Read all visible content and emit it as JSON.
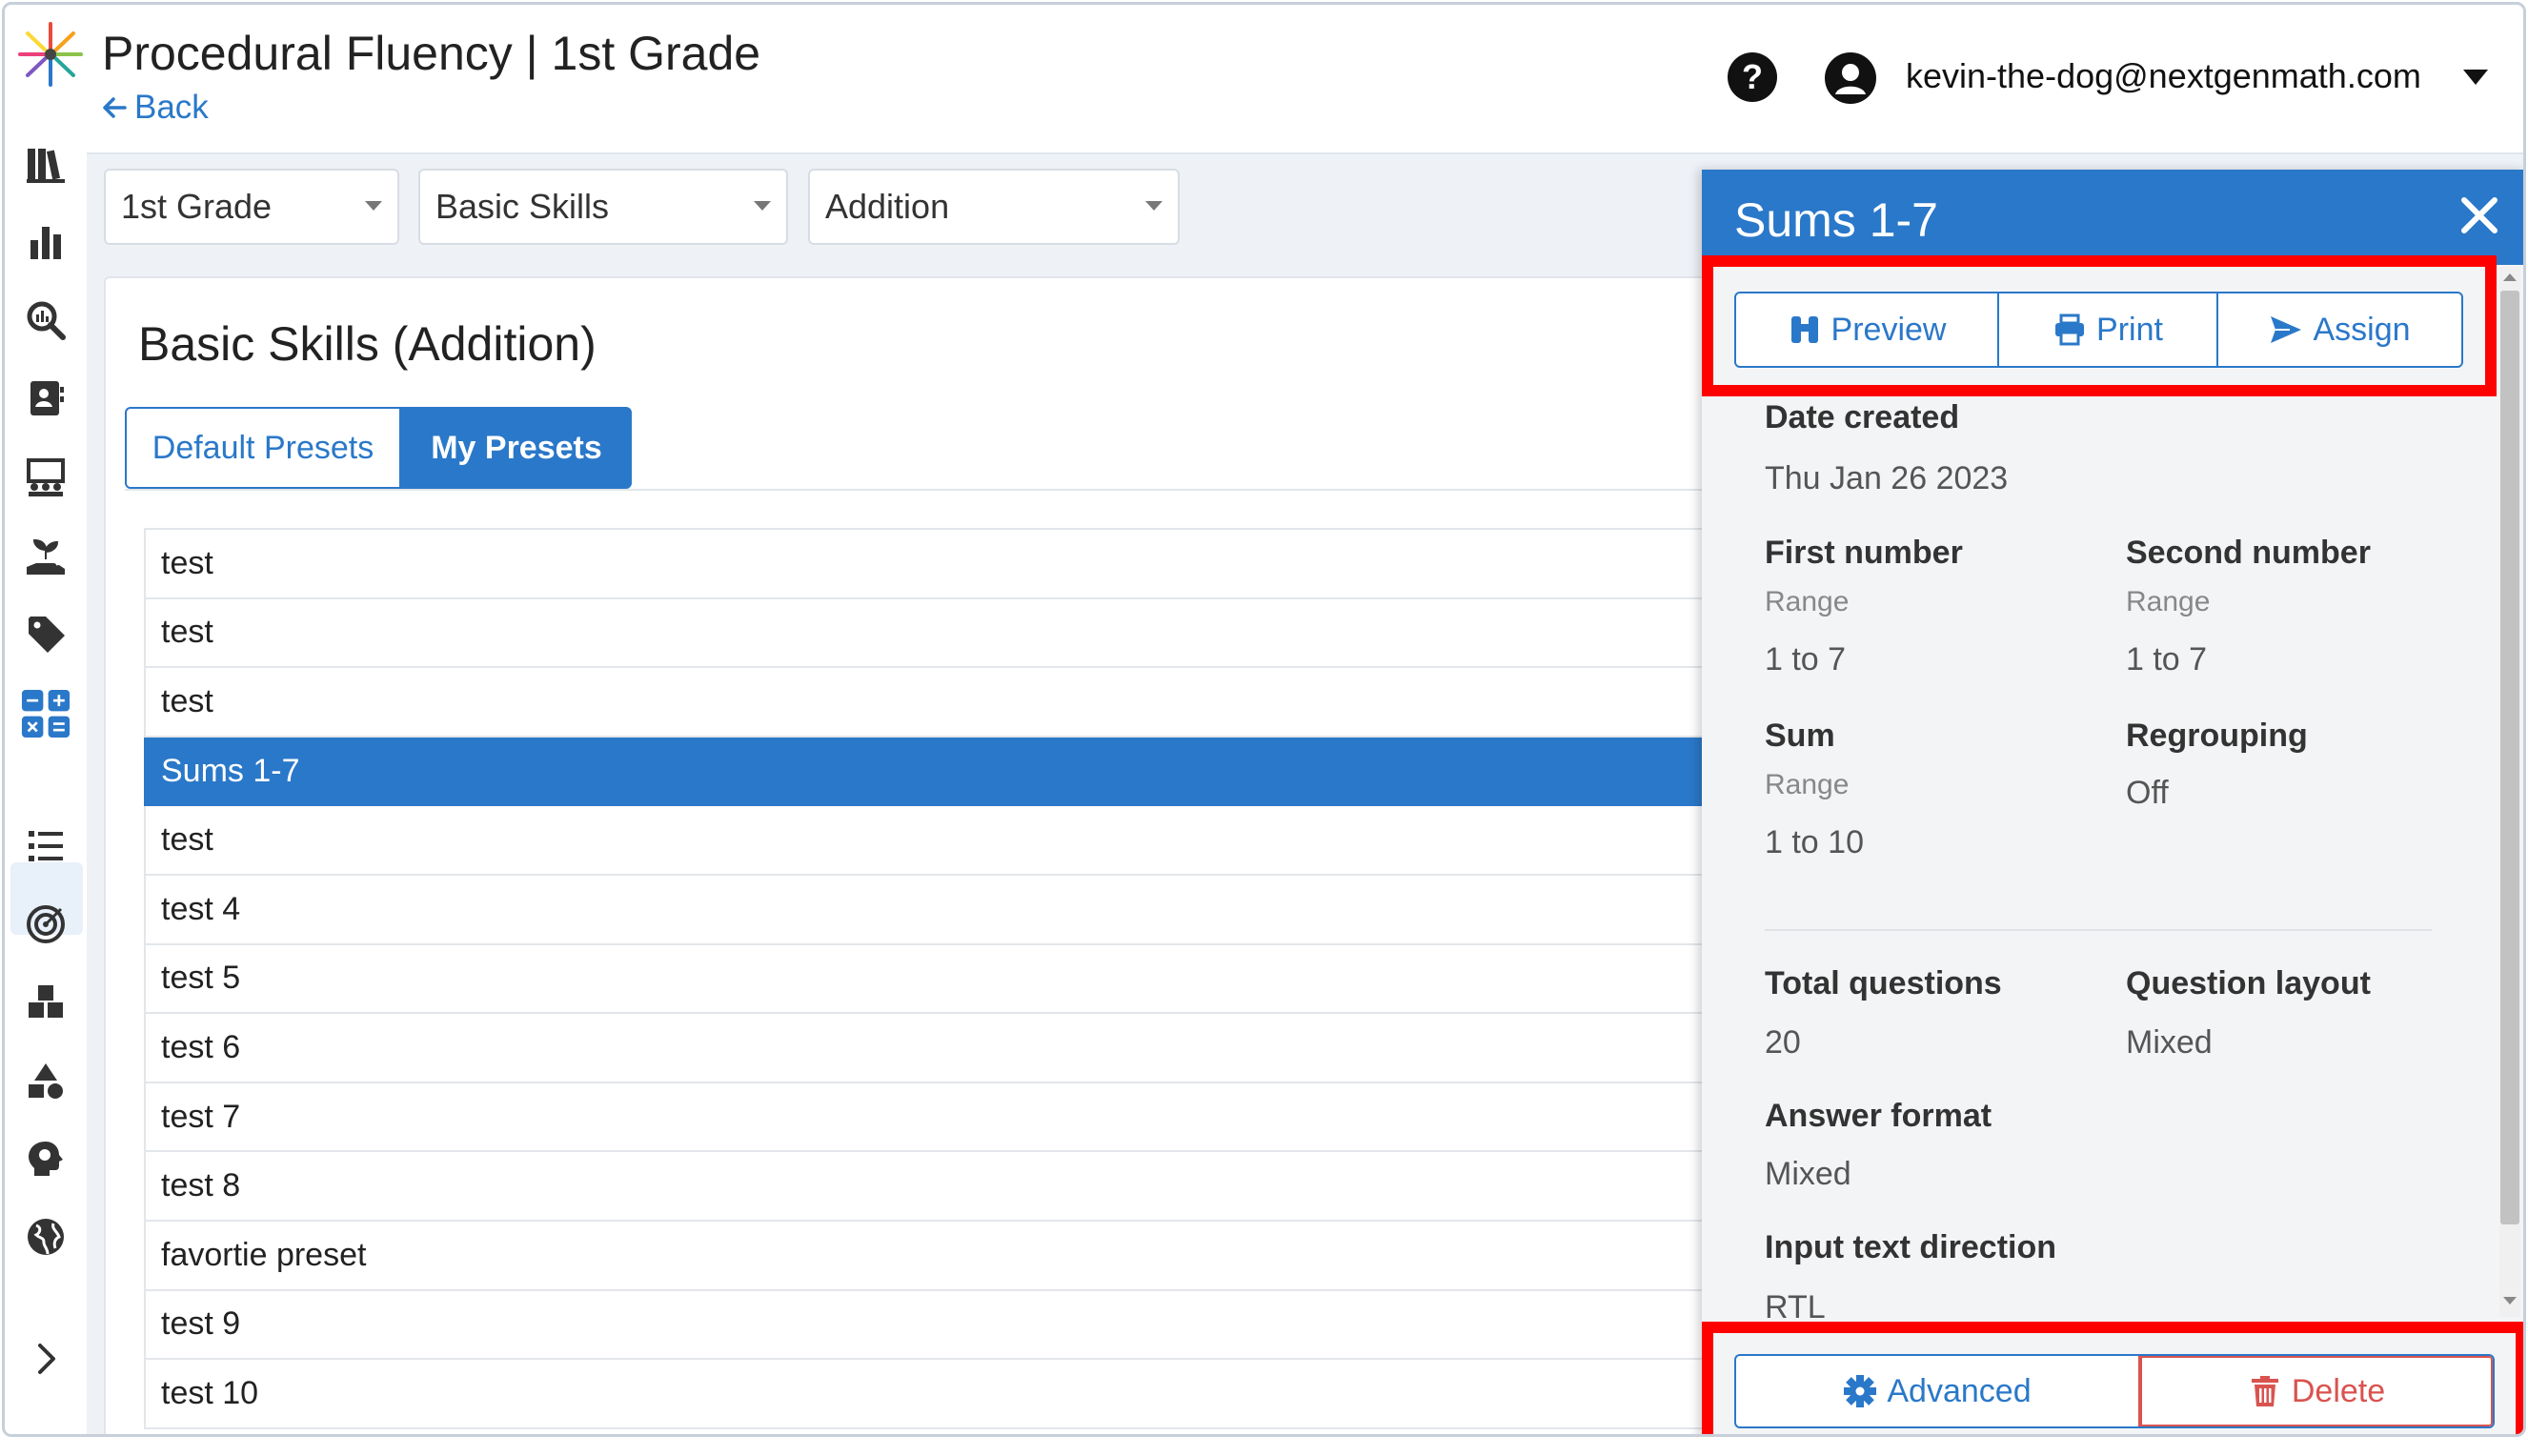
{
  "header": {
    "title": "Procedural Fluency | 1st Grade",
    "back_label": "Back",
    "help_label": "?",
    "user_email": "kevin-the-dog@nextgenmath.com"
  },
  "filters": {
    "grade": "1st Grade",
    "category": "Basic Skills",
    "operation": "Addition"
  },
  "card": {
    "title": "Basic Skills (Addition)",
    "tabs": [
      {
        "label": "Default Presets",
        "active": false
      },
      {
        "label": "My Presets",
        "active": true
      }
    ],
    "presets": [
      "test",
      "test",
      "test",
      "Sums 1-7",
      "test",
      "test 4",
      "test 5",
      "test 6",
      "test 7",
      "test 8",
      "favortie preset",
      "test 9",
      "test 10"
    ],
    "selected_index": 3
  },
  "panel": {
    "title": "Sums 1-7",
    "actions": {
      "preview": "Preview",
      "print": "Print",
      "assign": "Assign"
    },
    "date_created_label": "Date created",
    "date_created_value": "Thu Jan 26 2023",
    "first_number_label": "First number",
    "first_number_sub": "Range",
    "first_number_value": "1 to 7",
    "second_number_label": "Second number",
    "second_number_sub": "Range",
    "second_number_value": "1 to 7",
    "sum_label": "Sum",
    "sum_sub": "Range",
    "sum_value": "1 to 10",
    "regrouping_label": "Regrouping",
    "regrouping_value": "Off",
    "total_questions_label": "Total questions",
    "total_questions_value": "20",
    "question_layout_label": "Question layout",
    "question_layout_value": "Mixed",
    "answer_format_label": "Answer format",
    "answer_format_value": "Mixed",
    "input_direction_label": "Input text direction",
    "input_direction_value": "RTL",
    "advanced_label": "Advanced",
    "delete_label": "Delete"
  },
  "colors": {
    "primary": "#2a78c9",
    "danger": "#d9534f",
    "highlight": "#ff0000"
  }
}
